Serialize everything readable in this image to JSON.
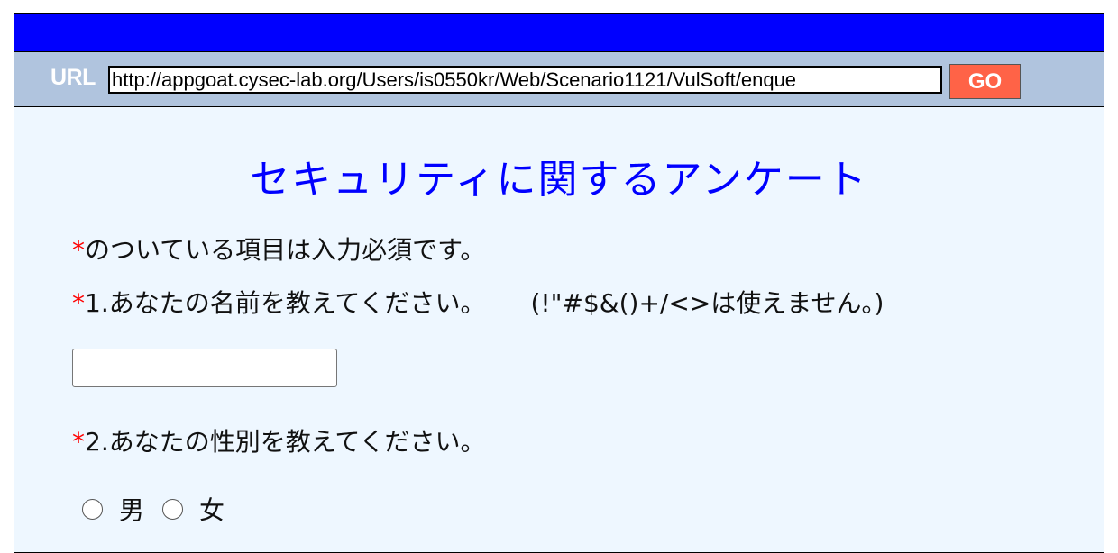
{
  "urlbar": {
    "label": "URL",
    "url": "http://appgoat.cysec-lab.org/Users/is0550kr/Web/Scenario1121/VulSoft/enque",
    "go_label": "GO"
  },
  "form": {
    "title": "セキュリティに関するアンケート",
    "required_mark": "*",
    "required_note": "のついている項目は入力必須です。",
    "q1_label": "1.あなたの名前を教えてください。",
    "q1_hint": "(!\"#$&()+/<>は使えません。)",
    "name_value": "",
    "q2_label": "2.あなたの性別を教えてください。",
    "gender_options": [
      "男",
      "女"
    ]
  },
  "colors": {
    "topbar": "#0000ff",
    "urlbar": "#b0c4de",
    "go_button": "#ff6347",
    "title": "#0000ff",
    "required": "#ff0000",
    "background": "#eef7ff"
  }
}
